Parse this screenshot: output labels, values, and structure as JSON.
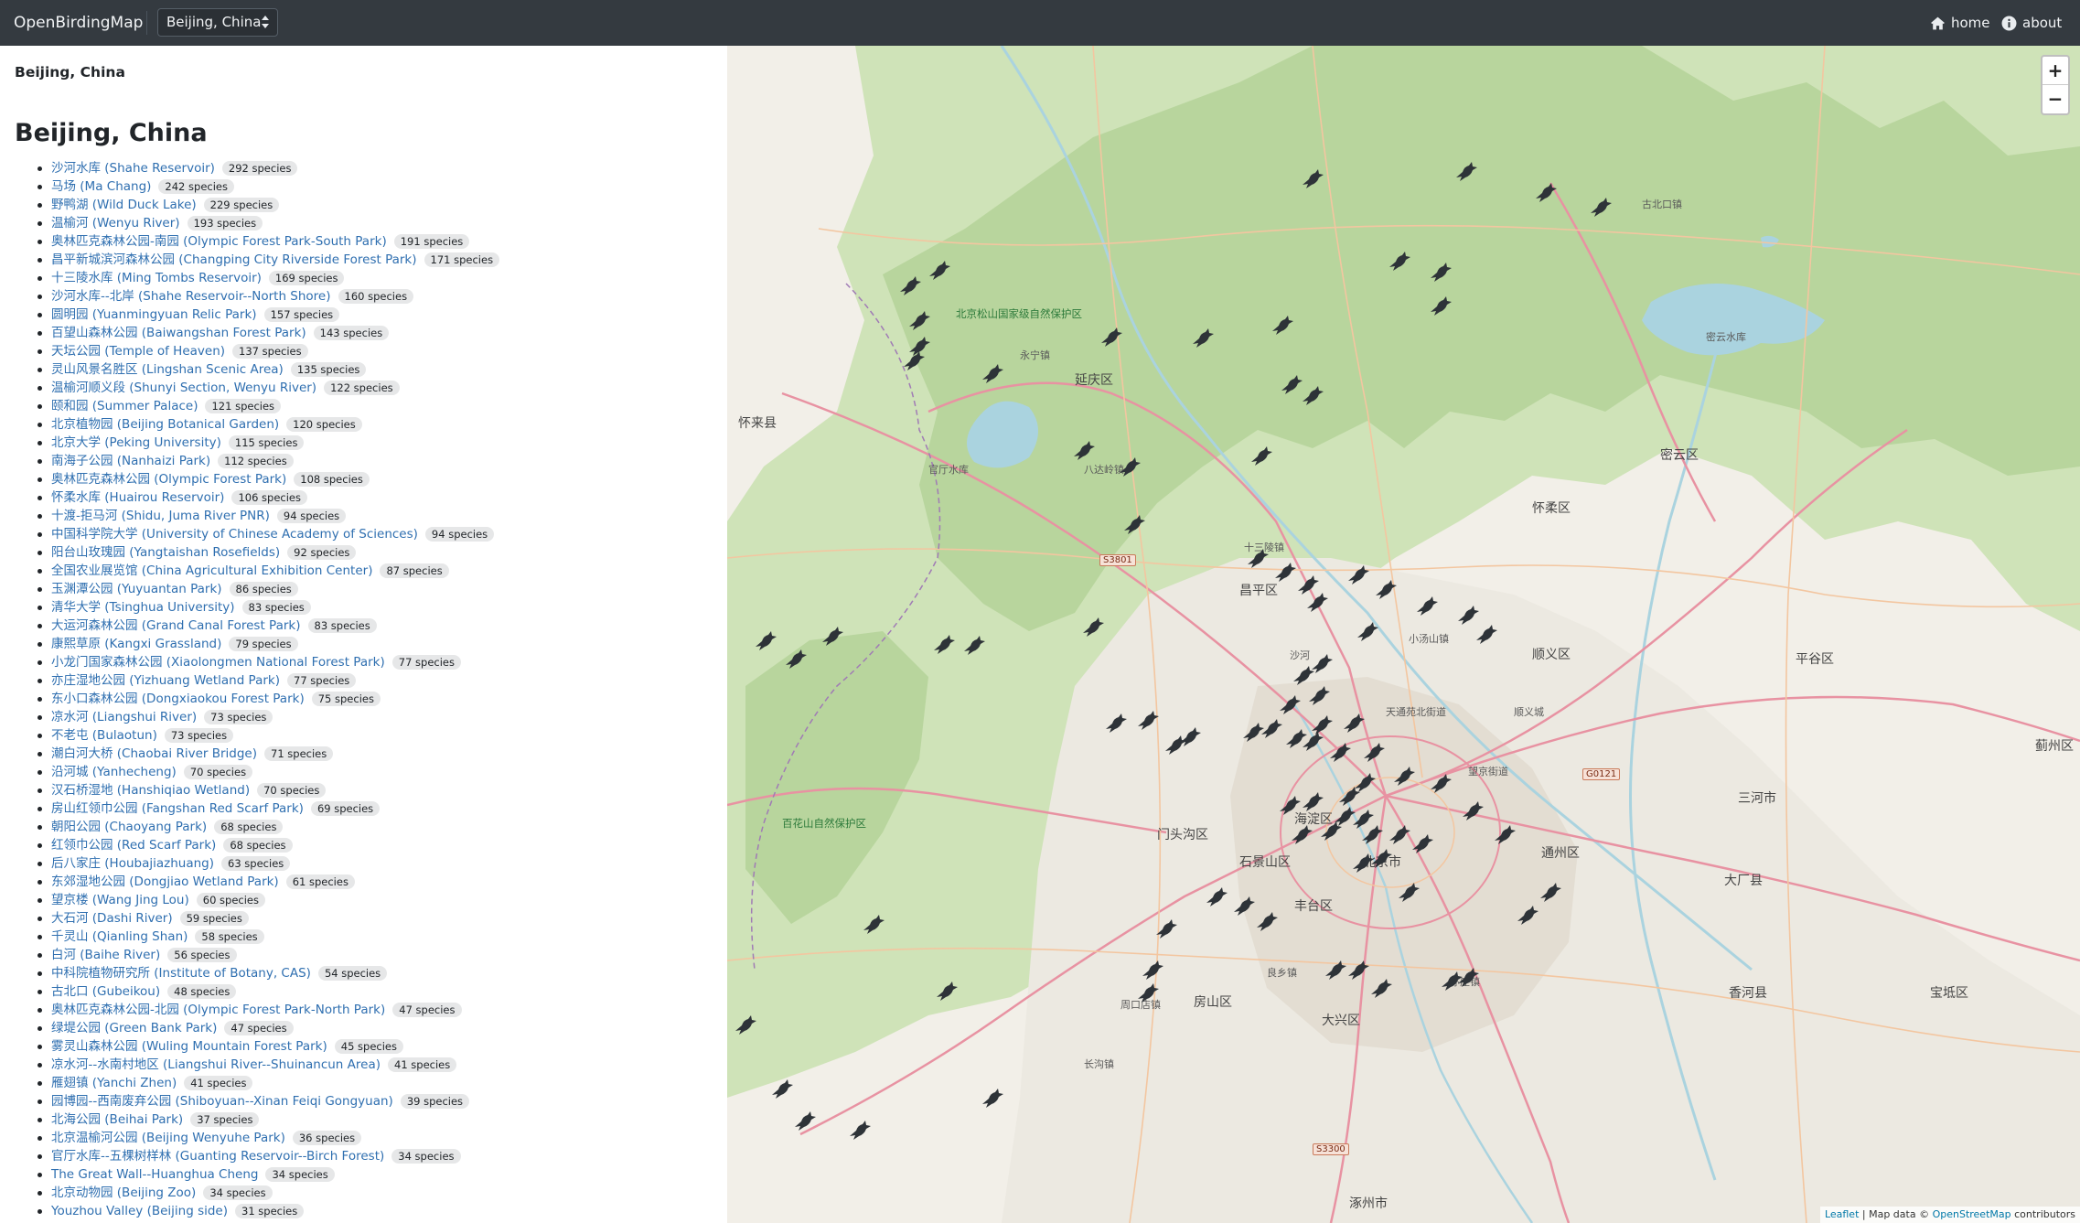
{
  "navbar": {
    "brand": "OpenBirdingMap",
    "region_select": "Beijing, China",
    "home_label": "home",
    "about_label": "about"
  },
  "sidebar": {
    "breadcrumb": "Beijing, China",
    "title": "Beijing, China",
    "hotspots": [
      {
        "name": "沙河水库 (Shahe Reservoir)",
        "species": "292 species"
      },
      {
        "name": "马场 (Ma Chang)",
        "species": "242 species"
      },
      {
        "name": "野鸭湖 (Wild Duck Lake)",
        "species": "229 species"
      },
      {
        "name": "温榆河 (Wenyu River)",
        "species": "193 species"
      },
      {
        "name": "奥林匹克森林公园-南园 (Olympic Forest Park-South Park)",
        "species": "191 species"
      },
      {
        "name": "昌平新城滨河森林公园 (Changping City Riverside Forest Park)",
        "species": "171 species"
      },
      {
        "name": "十三陵水库 (Ming Tombs Reservoir)",
        "species": "169 species"
      },
      {
        "name": "沙河水库--北岸 (Shahe Reservoir--North Shore)",
        "species": "160 species"
      },
      {
        "name": "圆明园 (Yuanmingyuan Relic Park)",
        "species": "157 species"
      },
      {
        "name": "百望山森林公园 (Baiwangshan Forest Park)",
        "species": "143 species"
      },
      {
        "name": "天坛公园 (Temple of Heaven)",
        "species": "137 species"
      },
      {
        "name": "灵山风景名胜区 (Lingshan Scenic Area)",
        "species": "135 species"
      },
      {
        "name": "温榆河顺义段 (Shunyi Section, Wenyu River)",
        "species": "122 species"
      },
      {
        "name": "颐和园 (Summer Palace)",
        "species": "121 species"
      },
      {
        "name": "北京植物园 (Beijing Botanical Garden)",
        "species": "120 species"
      },
      {
        "name": "北京大学 (Peking University)",
        "species": "115 species"
      },
      {
        "name": "南海子公园 (Nanhaizi Park)",
        "species": "112 species"
      },
      {
        "name": "奥林匹克森林公园 (Olympic Forest Park)",
        "species": "108 species"
      },
      {
        "name": "怀柔水库 (Huairou Reservoir)",
        "species": "106 species"
      },
      {
        "name": "十渡-拒马河 (Shidu, Juma River PNR)",
        "species": "94 species"
      },
      {
        "name": "中国科学院大学 (University of Chinese Academy of Sciences)",
        "species": "94 species"
      },
      {
        "name": "阳台山玫瑰园 (Yangtaishan Rosefields)",
        "species": "92 species"
      },
      {
        "name": "全国农业展览馆 (China Agricultural Exhibition Center)",
        "species": "87 species"
      },
      {
        "name": "玉渊潭公园 (Yuyuantan Park)",
        "species": "86 species"
      },
      {
        "name": "清华大学 (Tsinghua University)",
        "species": "83 species"
      },
      {
        "name": "大运河森林公园 (Grand Canal Forest Park)",
        "species": "83 species"
      },
      {
        "name": "康熙草原 (Kangxi Grassland)",
        "species": "79 species"
      },
      {
        "name": "小龙门国家森林公园 (Xiaolongmen National Forest Park)",
        "species": "77 species"
      },
      {
        "name": "亦庄湿地公园 (Yizhuang Wetland Park)",
        "species": "77 species"
      },
      {
        "name": "东小口森林公园 (Dongxiaokou Forest Park)",
        "species": "75 species"
      },
      {
        "name": "凉水河 (Liangshui River)",
        "species": "73 species"
      },
      {
        "name": "不老屯 (Bulaotun)",
        "species": "73 species"
      },
      {
        "name": "潮白河大桥 (Chaobai River Bridge)",
        "species": "71 species"
      },
      {
        "name": "沿河城 (Yanhecheng)",
        "species": "70 species"
      },
      {
        "name": "汉石桥湿地 (Hanshiqiao Wetland)",
        "species": "70 species"
      },
      {
        "name": "房山红领巾公园 (Fangshan Red Scarf Park)",
        "species": "69 species"
      },
      {
        "name": "朝阳公园 (Chaoyang Park)",
        "species": "68 species"
      },
      {
        "name": "红领巾公园 (Red Scarf Park)",
        "species": "68 species"
      },
      {
        "name": "后八家庄 (Houbajiazhuang)",
        "species": "63 species"
      },
      {
        "name": "东郊湿地公园 (Dongjiao Wetland Park)",
        "species": "61 species"
      },
      {
        "name": "望京楼 (Wang Jing Lou)",
        "species": "60 species"
      },
      {
        "name": "大石河 (Dashi River)",
        "species": "59 species"
      },
      {
        "name": "千灵山 (Qianling Shan)",
        "species": "58 species"
      },
      {
        "name": "白河 (Baihe River)",
        "species": "56 species"
      },
      {
        "name": "中科院植物研究所 (Institute of Botany, CAS)",
        "species": "54 species"
      },
      {
        "name": "古北口 (Gubeikou)",
        "species": "48 species"
      },
      {
        "name": "奥林匹克森林公园-北园 (Olympic Forest Park-North Park)",
        "species": "47 species"
      },
      {
        "name": "绿堤公园 (Green Bank Park)",
        "species": "47 species"
      },
      {
        "name": "雾灵山森林公园 (Wuling Mountain Forest Park)",
        "species": "45 species"
      },
      {
        "name": "凉水河--水南村地区 (Liangshui River--Shuinancun Area)",
        "species": "41 species"
      },
      {
        "name": "雁翅镇 (Yanchi Zhen)",
        "species": "41 species"
      },
      {
        "name": "园博园--西南废弃公园 (Shiboyuan--Xinan Feiqi Gongyuan)",
        "species": "39 species"
      },
      {
        "name": "北海公园 (Beihai Park)",
        "species": "37 species"
      },
      {
        "name": "北京温榆河公园 (Beijing Wenyuhe Park)",
        "species": "36 species"
      },
      {
        "name": "官厅水库--五棵树样林 (Guanting Reservoir--Birch Forest)",
        "species": "34 species"
      },
      {
        "name": "The Great Wall--Huanghua Cheng",
        "species": "34 species"
      },
      {
        "name": "北京动物园 (Beijing Zoo)",
        "species": "34 species"
      },
      {
        "name": "Youzhou Valley (Beijing side)",
        "species": "31 species"
      }
    ]
  },
  "map": {
    "zoom_in": "+",
    "zoom_out": "−",
    "attribution": {
      "leaflet": "Leaflet",
      "sep": " | Map data © ",
      "osm": "OpenStreetMap",
      "suffix": " contributors"
    },
    "labels": {
      "district_changping": "昌平区",
      "district_yanqing": "延庆区",
      "district_huairou": "怀柔区",
      "district_miyun": "密云区",
      "district_shunyi": "顺义区",
      "district_pinggu": "平谷区",
      "district_mentougou": "门头沟区",
      "district_haidian": "海淀区",
      "district_beijing": "北京市",
      "district_shijingshan": "石景山区",
      "district_fengtai": "丰台区",
      "district_tongzhou": "通州区",
      "district_fangshan": "房山区",
      "district_daxing": "大兴区",
      "district_sanhe": "三河市",
      "district_dachang": "大厂县",
      "district_xianghe": "香河县",
      "district_baodi": "宝坻区",
      "district_jizhou": "蓟州区",
      "district_huailai": "怀来县",
      "district_zhuozhou": "涿州市",
      "park_songshan": "北京松山国家级自然保护区",
      "park_baihuashan": "百花山自然保护区",
      "reservoir_miyun": "密云水库",
      "reservoir_guanting": "官厅水库",
      "route_s3801": "S3801",
      "route_g0121": "G0121",
      "route_s3300": "S3300",
      "town_yongning": "永宁镇",
      "town_shisanling": "十三陵镇",
      "town_bajiang": "八达岭镇",
      "town_xiaotangshan": "小汤山镇",
      "town_gubeikou": "古北口镇",
      "town_shahe": "沙河",
      "town_wangjing": "望京街道",
      "town_tiantongyuan": "天通苑北街道",
      "town_shunyi": "顺义城",
      "town_yizhuang": "亦庄镇",
      "town_liangxiang": "良乡镇",
      "town_changgou": "长沟镇",
      "town_zhoukoudian": "周口店镇"
    }
  }
}
